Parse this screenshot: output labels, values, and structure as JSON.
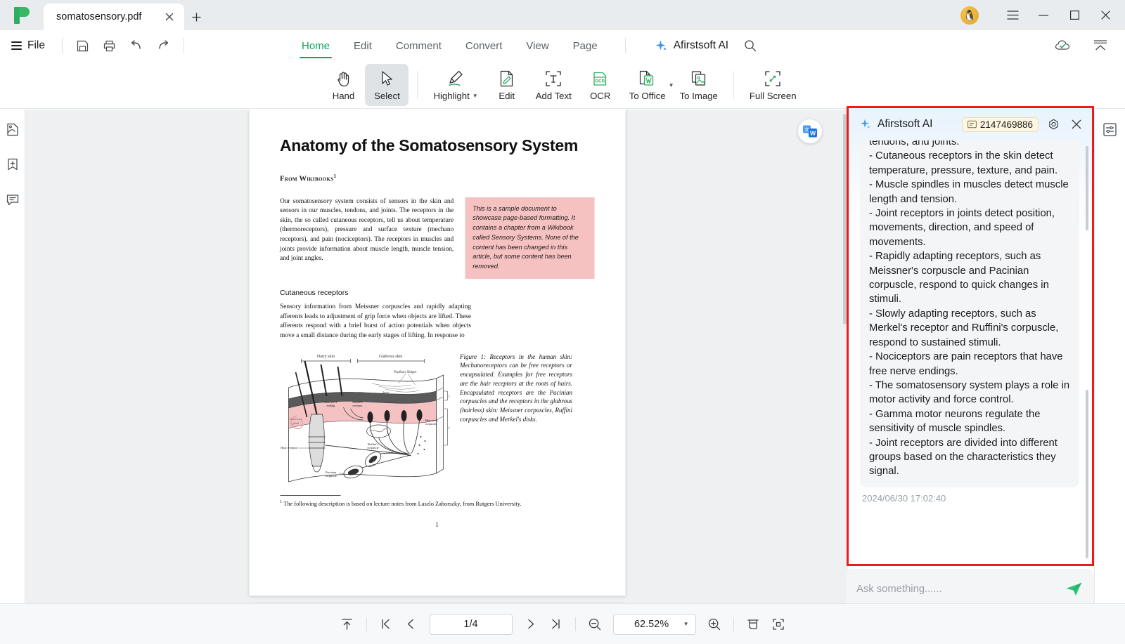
{
  "window": {
    "tab_title": "somatosensory.pdf",
    "close_tab_icon": "close-icon",
    "new_tab_icon": "plus-icon",
    "avatar_icon": "puffin-avatar",
    "menu_icon": "hamburger-icon",
    "minimize_icon": "minimize-icon",
    "maximize_icon": "maximize-icon",
    "close_icon": "close-icon"
  },
  "menubar": {
    "file_label": "File",
    "quick_actions": [
      {
        "name": "save-icon",
        "title": "Save"
      },
      {
        "name": "print-icon",
        "title": "Print"
      },
      {
        "name": "undo-icon",
        "title": "Undo"
      },
      {
        "name": "redo-icon",
        "title": "Redo"
      }
    ],
    "ribbon_tabs": [
      {
        "label": "Home",
        "active": true
      },
      {
        "label": "Edit",
        "active": false
      },
      {
        "label": "Comment",
        "active": false
      },
      {
        "label": "Convert",
        "active": false
      },
      {
        "label": "View",
        "active": false
      },
      {
        "label": "Page",
        "active": false
      }
    ],
    "ai_label": "Afirstsoft AI",
    "search_icon": "search-icon",
    "cloud_icon": "cloud-sync-icon",
    "collapse_icon": "collapse-ribbon-icon"
  },
  "ribbon": {
    "tools": [
      {
        "label": "Hand",
        "icon": "hand-icon",
        "active": false,
        "dropdown": false
      },
      {
        "label": "Select",
        "icon": "cursor-arrow-icon",
        "active": true,
        "dropdown": false
      },
      {
        "label": "Highlight",
        "icon": "highlighter-icon",
        "active": false,
        "dropdown": true
      },
      {
        "label": "Edit",
        "icon": "edit-document-icon",
        "active": false,
        "dropdown": false
      },
      {
        "label": "Add Text",
        "icon": "add-text-icon",
        "active": false,
        "dropdown": false
      },
      {
        "label": "OCR",
        "icon": "ocr-icon",
        "active": false,
        "dropdown": false
      },
      {
        "label": "To Office",
        "icon": "to-word-icon",
        "active": false,
        "dropdown": true
      },
      {
        "label": "To Image",
        "icon": "to-image-icon",
        "active": false,
        "dropdown": false
      },
      {
        "label": "Full Screen",
        "icon": "full-screen-icon",
        "active": false,
        "dropdown": false
      }
    ]
  },
  "left_rail": [
    {
      "name": "thumbnail-panel-icon"
    },
    {
      "name": "bookmark-panel-icon"
    },
    {
      "name": "comment-panel-icon"
    }
  ],
  "right_rail": [
    {
      "name": "panel-settings-icon"
    }
  ],
  "document": {
    "title": "Anatomy of the Somatosensory System",
    "source": "From Wikibooks",
    "source_sup": "1",
    "intro_paragraph": "Our somatosensory system consists of sensors in the skin and sensors in our muscles, tendons, and joints. The receptors in the skin, the so called cutaneous receptors, tell us about temperature (thermoreceptors), pressure and surface texture (mechano receptors), and pain (nociceptors). The receptors in muscles and joints provide information about muscle length, muscle tension, and joint angles.",
    "callout": "This is a sample document to showcase page-based formatting. It contains a chapter from a Wikibook called Sensory Systems. None of the content has been changed in this article, but some content has been removed.",
    "section_heading": "Cutaneous receptors",
    "section_paragraph": "Sensory information from Meissner corpuscles and rapidly adapting afferents leads to adjustment of grip force when objects are lifted. These afferents respond with a brief burst of action potentials when objects move a small distance during the early stages of lifting. In response to",
    "figure_caption": "Figure 1: Receptors in the human skin: Mechanoreceptors can be free receptors or encapsulated. Examples for free receptors are the hair receptors at the roots of hairs. Encapsulated receptors are the Pacinian corpuscles and the receptors in the glabrous (hairless) skin: Meissner corpuscles, Ruffini corpuscles and Merkel's disks.",
    "figure_labels": {
      "hairy_skin": "Hairy skin",
      "glabrous_skin": "Glabrous skin",
      "papillary_ridges": "Papillary Ridges",
      "septa": "Septa",
      "epidermis": "Epidermis",
      "dermis": "Dermis",
      "free_nerve_ending": "Free nerve ending",
      "merkel_receptor": "Merkel's receptor",
      "meissner_corpuscle": "Meissner's corpuscle",
      "ruffini_corpuscle": "Ruffini's corpuscle",
      "sebaceous_gland": "Sebaceous gland",
      "hair_receptor": "Hair receptor",
      "pacinian_corpuscle": "Pacinian corpuscle"
    },
    "footnote_marker": "1",
    "footnote": "The following description is based on lecture notes from Laszlo Zaborszky, from Rutgers University.",
    "page_number": "1",
    "translate_fab_icon": "translate-to-word-icon"
  },
  "ai_panel": {
    "title": "Afirstsoft AI",
    "token_icon": "token-icon",
    "token_count": "2147469886",
    "settings_icon": "settings-icon",
    "close_icon": "close-icon",
    "message": "tendons, and joints.\n- Cutaneous receptors in the skin detect temperature, pressure, texture, and pain.\n- Muscle spindles in muscles detect muscle length and tension.\n- Joint receptors in joints detect position, movements, direction, and speed of movements.\n- Rapidly adapting receptors, such as Meissner's corpuscle and Pacinian corpuscle, respond to quick changes in stimuli.\n- Slowly adapting receptors, such as Merkel's receptor and Ruffini's corpuscle, respond to sustained stimuli.\n- Nociceptors are pain receptors that have free nerve endings.\n- The somatosensory system plays a role in motor activity and force control.\n- Gamma motor neurons regulate the sensitivity of muscle spindles.\n- Joint receptors are divided into different groups based on the characteristics they signal.",
    "timestamp": "2024/06/30 17:02:40",
    "input_placeholder": "Ask something......",
    "send_icon": "send-icon",
    "accent_color": "#ee1b1b"
  },
  "bottom_bar": {
    "scroll_top_icon": "scroll-to-top-icon",
    "first_page_icon": "first-page-icon",
    "prev_page_icon": "prev-page-icon",
    "page_indicator": "1/4",
    "next_page_icon": "next-page-icon",
    "last_page_icon": "last-page-icon",
    "zoom_out_icon": "zoom-out-icon",
    "zoom_level": "62.52%",
    "zoom_caret_icon": "chevron-down-icon",
    "zoom_in_icon": "zoom-in-icon",
    "fit_width_icon": "fit-width-icon",
    "fit_page_icon": "fit-page-icon"
  },
  "theme": {
    "brand_green": "#12a45c",
    "ai_red": "#ee1b1b",
    "titlebar_bg": "#e8ecef"
  }
}
